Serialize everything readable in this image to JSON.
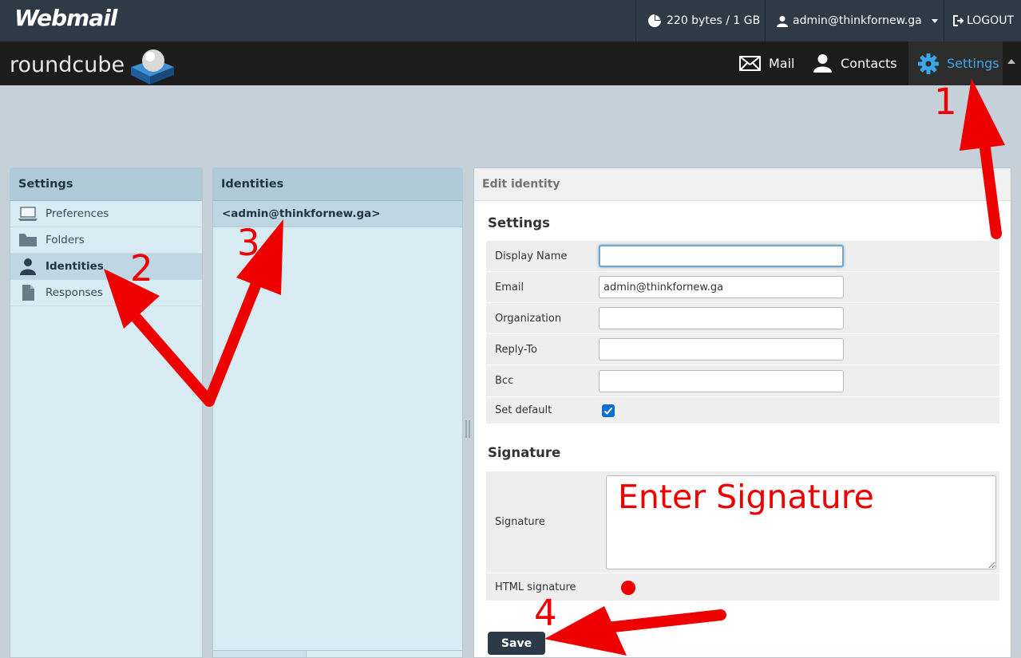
{
  "topbar": {
    "brand": "Webmail",
    "quota": "220 bytes / 1 GB",
    "user": "admin@thinkfornew.ga",
    "logout": "LOGOUT"
  },
  "header": {
    "logo_text": "roundcube",
    "tabs": [
      {
        "label": "Mail",
        "icon": "envelope-icon"
      },
      {
        "label": "Contacts",
        "icon": "person-icon"
      },
      {
        "label": "Settings",
        "icon": "gear-icon",
        "active": true
      }
    ]
  },
  "settings_panel": {
    "title": "Settings",
    "items": [
      {
        "label": "Preferences",
        "icon": "laptop-icon"
      },
      {
        "label": "Folders",
        "icon": "folder-icon"
      },
      {
        "label": "Identities",
        "icon": "user-icon",
        "selected": true
      },
      {
        "label": "Responses",
        "icon": "document-icon"
      }
    ]
  },
  "identities_panel": {
    "title": "Identities",
    "items": [
      "<admin@thinkfornew.ga>"
    ]
  },
  "edit_panel": {
    "title": "Edit identity",
    "settings_title": "Settings",
    "fields": {
      "display_name": {
        "label": "Display Name",
        "value": ""
      },
      "email": {
        "label": "Email",
        "value": "admin@thinkfornew.ga"
      },
      "organization": {
        "label": "Organization",
        "value": ""
      },
      "reply_to": {
        "label": "Reply-To",
        "value": ""
      },
      "bcc": {
        "label": "Bcc",
        "value": ""
      },
      "set_default": {
        "label": "Set default",
        "checked": true
      }
    },
    "signature_title": "Signature",
    "signature_label": "Signature",
    "signature_value": "",
    "html_signature_label": "HTML signature",
    "save_label": "Save"
  },
  "annotations": {
    "step1": "1",
    "step2": "2",
    "step3": "3",
    "step4": "4",
    "signature_note": "Enter Signature",
    "color": "#ee0000"
  },
  "colors": {
    "topbar": "#2f3a47",
    "header": "#1c1c1c",
    "accent": "#3ba6ea",
    "panel": "#d9ebf3",
    "panel_header": "#aecad8"
  }
}
